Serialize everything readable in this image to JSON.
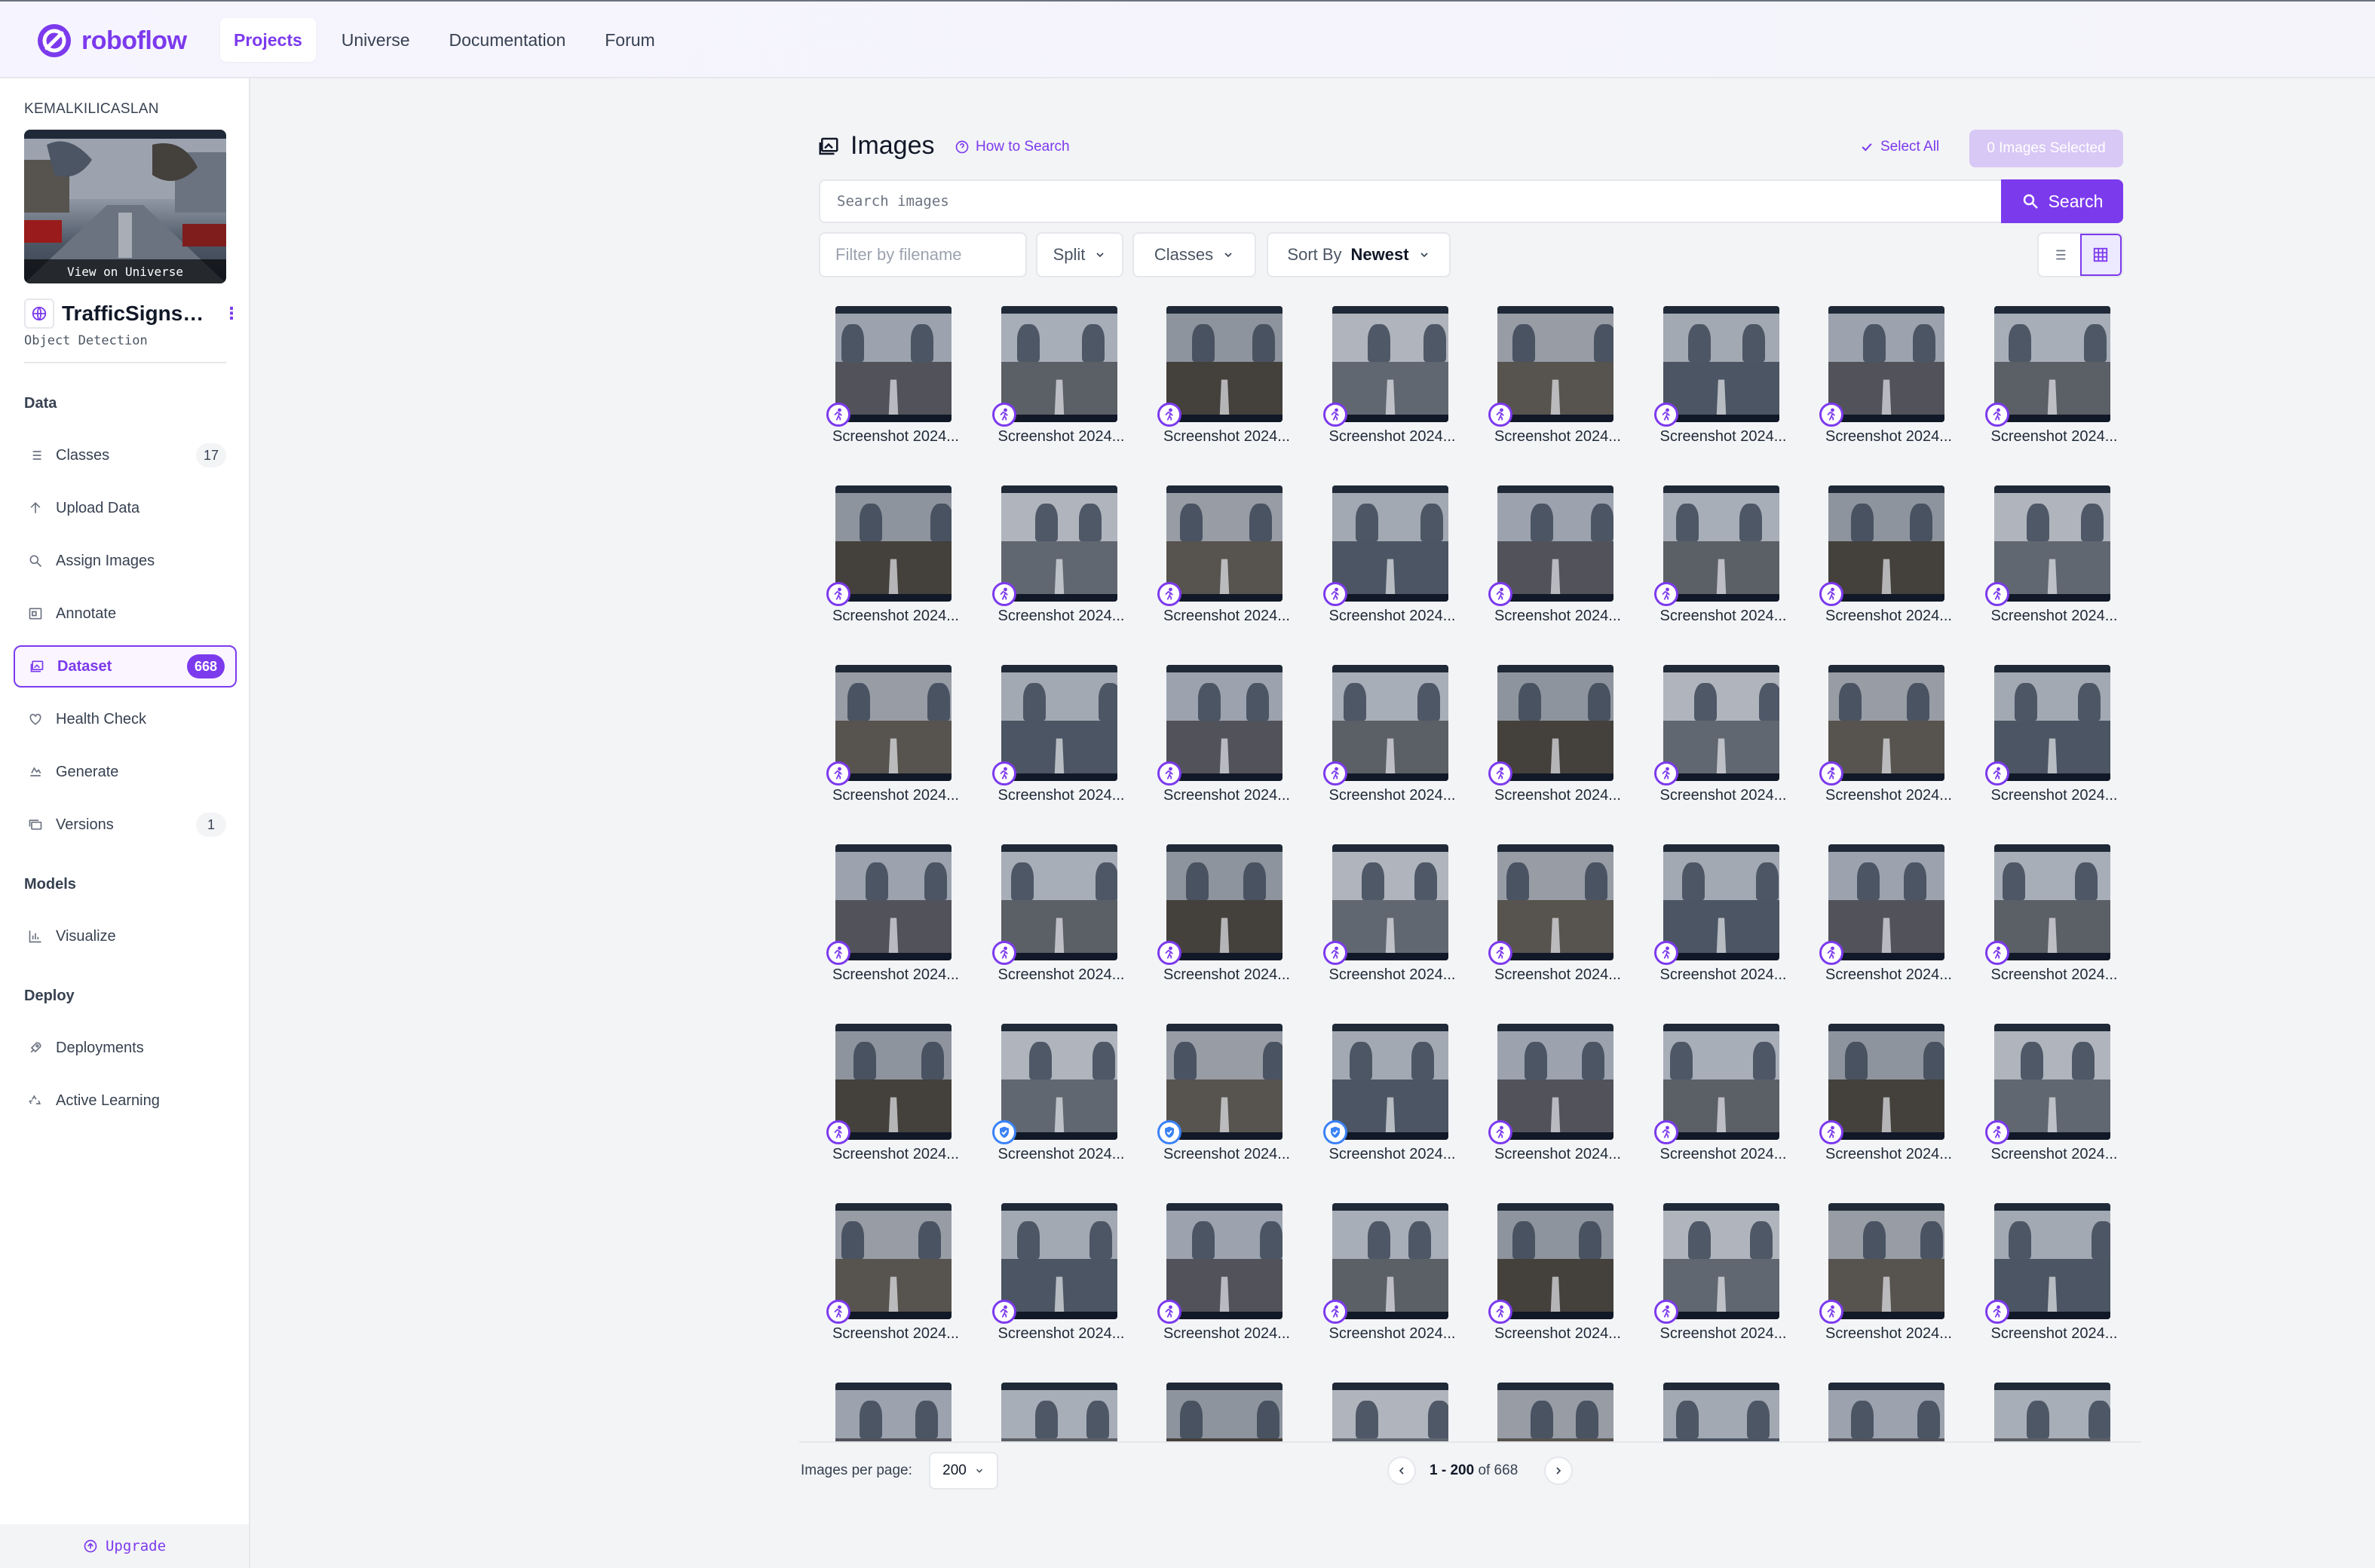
{
  "app": {
    "logo_text": "roboflow",
    "brand_color": "#7c3aed"
  },
  "nav": {
    "items": [
      {
        "label": "Projects",
        "active": true
      },
      {
        "label": "Universe",
        "active": false
      },
      {
        "label": "Documentation",
        "active": false
      },
      {
        "label": "Forum",
        "active": false
      }
    ]
  },
  "sidebar": {
    "workspace": "KEMALKILICASLAN",
    "view_on_universe": "View on Universe",
    "project_name": "TrafficSignsRe...",
    "project_type": "Object Detection",
    "sections": {
      "data": "Data",
      "models": "Models",
      "deploy": "Deploy"
    },
    "items": [
      {
        "label": "Classes",
        "count": "17",
        "icon": "list-icon"
      },
      {
        "label": "Upload Data",
        "count": "",
        "icon": "upload-icon"
      },
      {
        "label": "Assign Images",
        "count": "",
        "icon": "search-icon"
      },
      {
        "label": "Annotate",
        "count": "",
        "icon": "annotate-icon"
      },
      {
        "label": "Dataset",
        "count": "668",
        "icon": "images-icon",
        "active": true
      },
      {
        "label": "Health Check",
        "count": "",
        "icon": "heart-icon"
      },
      {
        "label": "Generate",
        "count": "",
        "icon": "generate-icon"
      },
      {
        "label": "Versions",
        "count": "1",
        "icon": "versions-icon"
      },
      {
        "label": "Visualize",
        "count": "",
        "icon": "chart-icon"
      },
      {
        "label": "Deployments",
        "count": "",
        "icon": "rocket-icon"
      },
      {
        "label": "Active Learning",
        "count": "",
        "icon": "recycle-icon"
      }
    ],
    "upgrade": "Upgrade"
  },
  "main": {
    "title": "Images",
    "how_to_search": "How to Search",
    "select_all": "Select All",
    "images_selected": "0 Images Selected",
    "search_placeholder": "Search images",
    "search_button": "Search",
    "filter_placeholder": "Filter by filename",
    "split_label": "Split",
    "classes_label": "Classes",
    "sort_by_label": "Sort By",
    "sort_by_value": "Newest"
  },
  "grid": {
    "tile_label": "Screenshot 2024...",
    "rows": [
      [
        "run",
        "run",
        "run",
        "run",
        "run",
        "run",
        "run",
        "run"
      ],
      [
        "run",
        "run",
        "run",
        "run",
        "run",
        "run",
        "run",
        "run"
      ],
      [
        "run",
        "run",
        "run",
        "run",
        "run",
        "run",
        "run",
        "run"
      ],
      [
        "run",
        "run",
        "run",
        "run",
        "run",
        "run",
        "run",
        "run"
      ],
      [
        "run",
        "shield",
        "shield",
        "shield",
        "run",
        "run",
        "run",
        "run"
      ],
      [
        "run",
        "run",
        "run",
        "run",
        "run",
        "run",
        "run",
        "run"
      ],
      [
        "none",
        "none",
        "none",
        "none",
        "none",
        "none",
        "none",
        "none"
      ]
    ]
  },
  "pagination": {
    "per_page_label": "Images per page:",
    "per_page_value": "200",
    "range": "1 - 200",
    "of_text": "of 668"
  }
}
